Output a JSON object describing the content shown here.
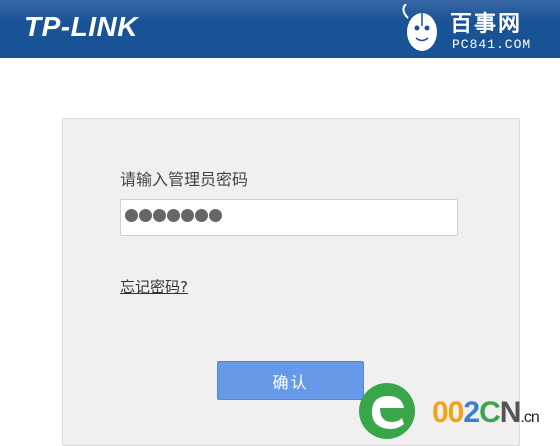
{
  "header": {
    "brand": "TP-LINK",
    "watermark_title": "百事网",
    "watermark_url": "PC841.COM"
  },
  "login": {
    "label": "请输入管理员密码",
    "password_value": "•••••••",
    "forgot_link": "忘记密码?",
    "confirm_button": "确认"
  },
  "corner_watermark": {
    "part1": "00",
    "part2": "2",
    "part3": "C",
    "part4": "N",
    "tld": ".cn"
  },
  "colors": {
    "header_bg": "#1a5296",
    "panel_bg": "#f0f0f0",
    "button_bg": "#6699e8"
  }
}
